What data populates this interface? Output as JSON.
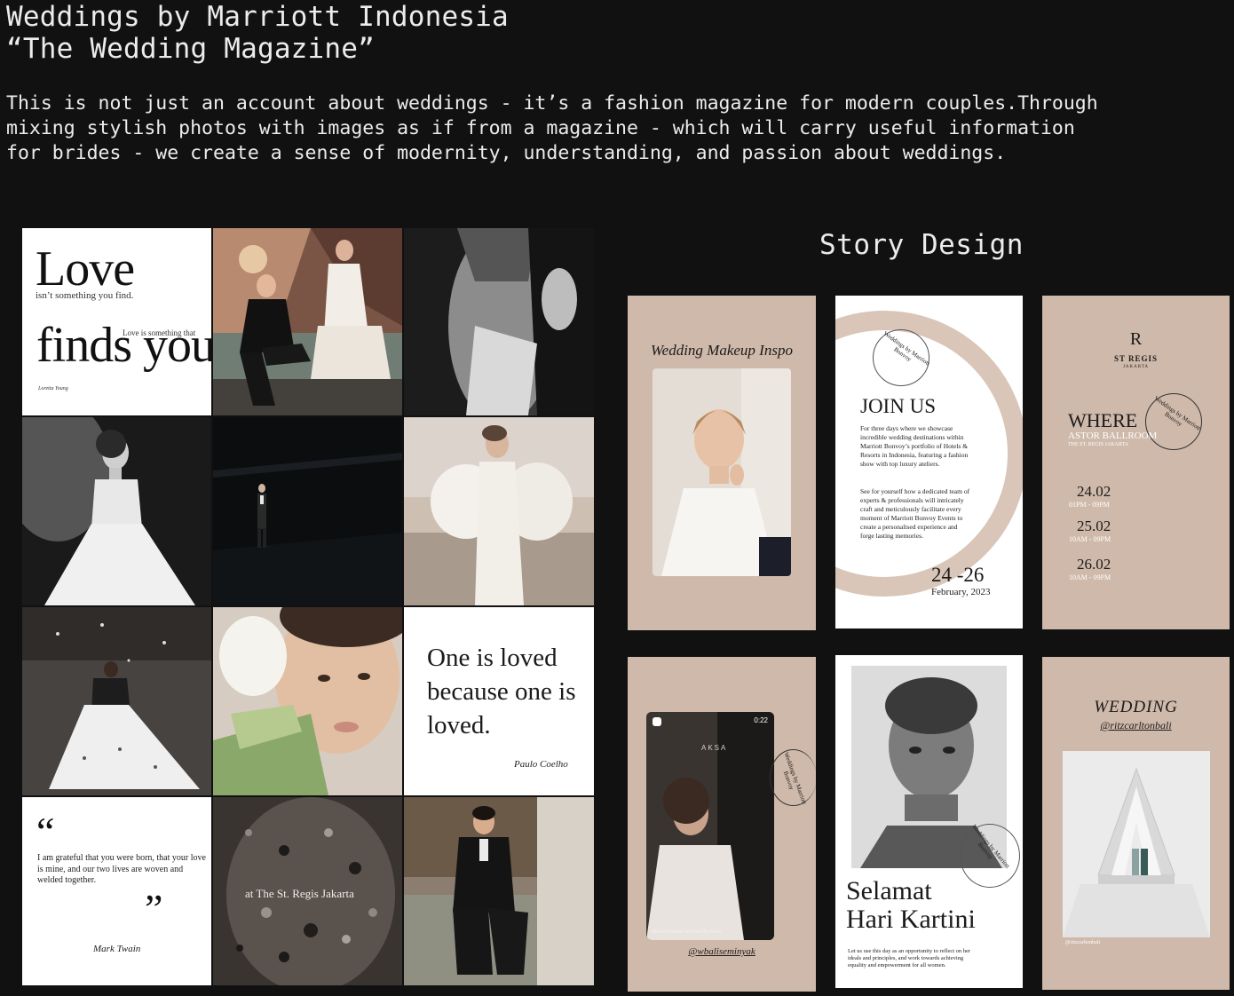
{
  "header": {
    "title": "Weddings by Marriott Indonesia",
    "subtitle": "“The Wedding Magazine”",
    "description": "This is not just an account about weddings - it’s a fashion magazine for modern couples.Through\nmixing stylish photos with images as if from a magazine - which will carry useful information\nfor brides - we create a sense of modernity, understanding, and passion about weddings."
  },
  "feed": {
    "love_post": {
      "big": "Love",
      "small": "isn’t something you find.",
      "tag": "Love is something that",
      "finds": "finds you",
      "author": "Loretta Young"
    },
    "quote_post": {
      "text": "One is loved because one is loved.",
      "author": "Paulo Coelho"
    },
    "twain_post": {
      "open_quote": "“",
      "text": "I am grateful that you were born, that your love is mine, and our two lives are woven and welded together.",
      "close_quote": "”",
      "author": "Mark Twain"
    },
    "regis_post": {
      "caption": "at The St. Regis Jakarta"
    }
  },
  "story": {
    "title": "Story Design",
    "makeup": {
      "title": "Wedding Makeup Inspo"
    },
    "join": {
      "badge": "Weddings by Marriott Bonvoy",
      "heading": "JOIN US",
      "p1": "For three days where we showcase incredible wedding destinations within Marriott Bonvoy’s portfolio of Hotels & Resorts in Indonesia, featuring a fashion show with top luxury ateliers.",
      "p2": "See for yourself how a dedicated team of experts & professionals will intricately craft and meticulously facilitate every moment of Marriott Bonvoy Events to create a personalised experience and forge lasting memories.",
      "dates": "24 -26",
      "month": "February, 2023"
    },
    "regis": {
      "logo_mark": "R",
      "logo_name": "ST REGIS",
      "logo_city": "JAKARTA",
      "badge": "Weddings by Marriott Bonvoy",
      "where": "WHERE",
      "venue": "ASTOR BALLROOM",
      "venue_sub": "THE ST. REGIS JAKARTA",
      "schedule": [
        {
          "date": "24.02",
          "time": "01PM - 09PM"
        },
        {
          "date": "25.02",
          "time": "10AM - 09PM"
        },
        {
          "date": "26.02",
          "time": "10AM - 09PM"
        }
      ]
    },
    "video": {
      "time": "0:22",
      "brand": "AKSA",
      "badge": "Weddings by Marriott Bonvoy",
      "caption": "aksa.creative and adrihumam",
      "handle": "@wbaliseminyak"
    },
    "kartini": {
      "badge": "Weddings by Marriott Bonvoy",
      "title_line1": "Selamat",
      "title_line2": "Hari Kartini",
      "body": "Let us use this day as an opportunity to reflect on her ideals and principles, and work towards achieving equality and empowerment for all women."
    },
    "ritz": {
      "title": "WEDDING",
      "handle": "@ritzcarltonbali",
      "photo_credit": "@ritzcarltonbali"
    }
  },
  "colors": {
    "background": "#111111",
    "beige": "#cfb9aa",
    "text": "#ececec"
  }
}
